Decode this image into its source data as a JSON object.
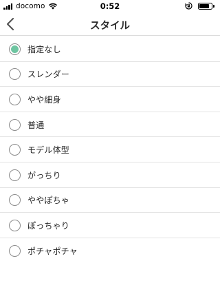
{
  "status_bar": {
    "carrier": "docomo",
    "time": "0:52",
    "battery_level": 0.85
  },
  "nav": {
    "title": "スタイル",
    "back_icon": "chevron-left-icon"
  },
  "options": [
    {
      "label": "指定なし",
      "selected": true
    },
    {
      "label": "スレンダー",
      "selected": false
    },
    {
      "label": "やや細身",
      "selected": false
    },
    {
      "label": "普通",
      "selected": false
    },
    {
      "label": "モデル体型",
      "selected": false
    },
    {
      "label": "がっちり",
      "selected": false
    },
    {
      "label": "ややぽちゃ",
      "selected": false
    },
    {
      "label": "ぽっちゃり",
      "selected": false
    },
    {
      "label": "ポチャポチャ",
      "selected": false
    }
  ],
  "colors": {
    "accent": "#6ec5a1",
    "radio_border": "#8c8c8c",
    "divider": "#e4e4e4"
  }
}
